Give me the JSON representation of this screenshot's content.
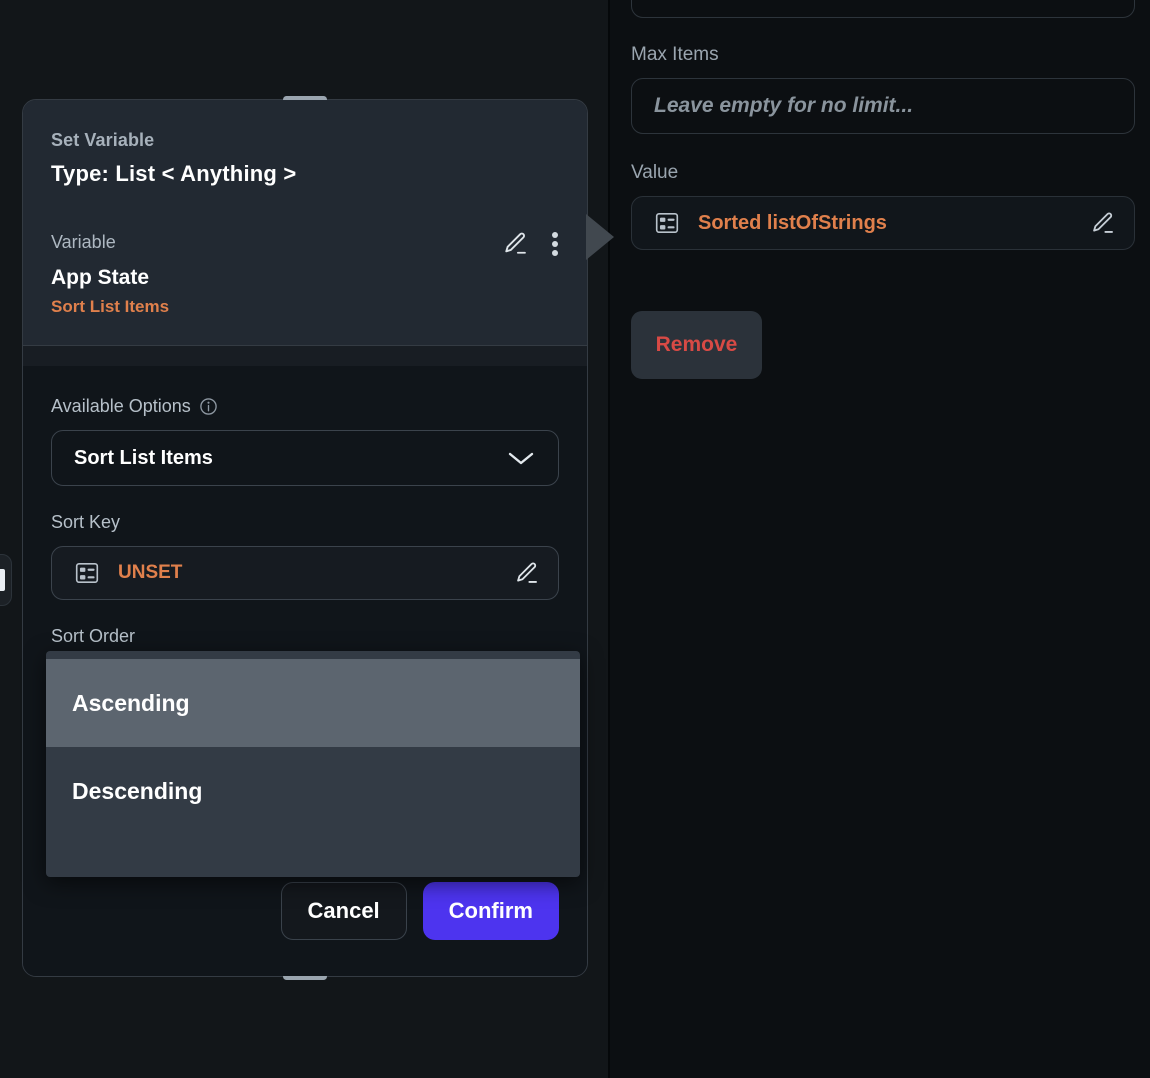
{
  "node_card": {
    "header": {
      "subtitle": "Set Variable",
      "title": "Type: List < Anything >"
    },
    "variable_section": {
      "label": "Variable",
      "name": "App State",
      "tag": "Sort List Items",
      "edit_icon": "pencil-icon",
      "menu_icon": "more-vertical-icon"
    },
    "body": {
      "available_options_label": "Available Options",
      "available_options_info_icon": "info-circle-icon",
      "available_options_value": "Sort List Items",
      "chevron_icon": "chevron-down-icon",
      "sort_key_label": "Sort Key",
      "sort_key_value": "UNSET",
      "sort_key_binding_icon": "list-binding-icon",
      "sort_key_edit_icon": "pencil-icon",
      "sort_order_label": "Sort Order"
    },
    "actions": {
      "cancel_label": "Cancel",
      "confirm_label": "Confirm"
    }
  },
  "dropdown": {
    "options": [
      {
        "label": "Ascending",
        "selected": true
      },
      {
        "label": "Descending",
        "selected": false
      }
    ]
  },
  "right_panel": {
    "max_items_label": "Max Items",
    "max_items_placeholder": "Leave empty for no limit...",
    "max_items_value": "",
    "value_label": "Value",
    "value_binding": "Sorted listOfStrings",
    "value_binding_icon": "list-binding-icon",
    "value_edit_icon": "pencil-icon",
    "remove_label": "Remove"
  },
  "colors": {
    "accent_orange": "#e0804c",
    "confirm_purple": "#4d34ef",
    "remove_red": "#d84a45",
    "card_bg": "#222932",
    "body_bg": "#10151a",
    "canvas_bg": "#121619",
    "panel_bg": "#0c0f12",
    "dropdown_bg": "#333b45",
    "dropdown_selected": "#5c656f"
  }
}
